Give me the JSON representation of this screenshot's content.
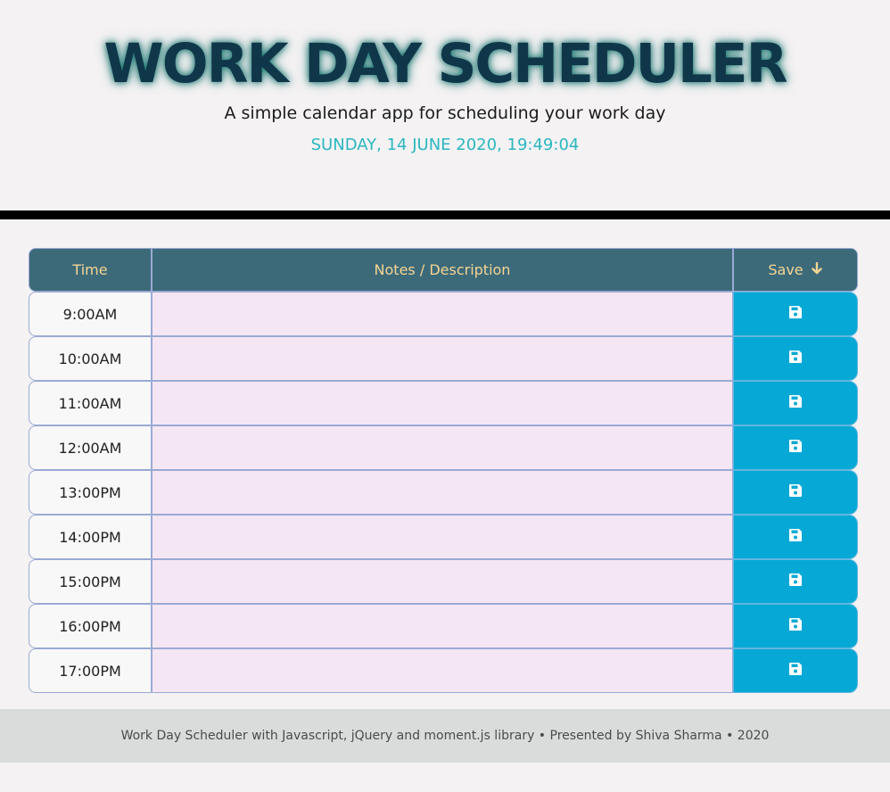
{
  "header": {
    "title": "WORK DAY SCHEDULER",
    "subtitle": "A simple calendar app for scheduling your work day",
    "datetime": "SUNDAY, 14 JUNE 2020, 19:49:04"
  },
  "table": {
    "headers": {
      "time": "Time",
      "notes": "Notes / Description",
      "save": "Save",
      "save_icon": "arrow-down-icon"
    },
    "rows": [
      {
        "time": "9:00AM",
        "note": ""
      },
      {
        "time": "10:00AM",
        "note": ""
      },
      {
        "time": "11:00AM",
        "note": ""
      },
      {
        "time": "12:00AM",
        "note": ""
      },
      {
        "time": "13:00PM",
        "note": ""
      },
      {
        "time": "14:00PM",
        "note": ""
      },
      {
        "time": "15:00PM",
        "note": ""
      },
      {
        "time": "16:00PM",
        "note": ""
      },
      {
        "time": "17:00PM",
        "note": ""
      }
    ],
    "save_button_icon": "floppy-disk-icon"
  },
  "footer": {
    "text": "Work Day Scheduler with Javascript, jQuery and moment.js library • Presented by Shiva Sharma • 2020"
  },
  "colors": {
    "header_row": "#3d6a79",
    "header_text": "#f3d594",
    "notes_bg": "#f5e6f4",
    "save_button": "#06a9d5",
    "datetime": "#2ab7c0",
    "title": "#0f3749"
  }
}
